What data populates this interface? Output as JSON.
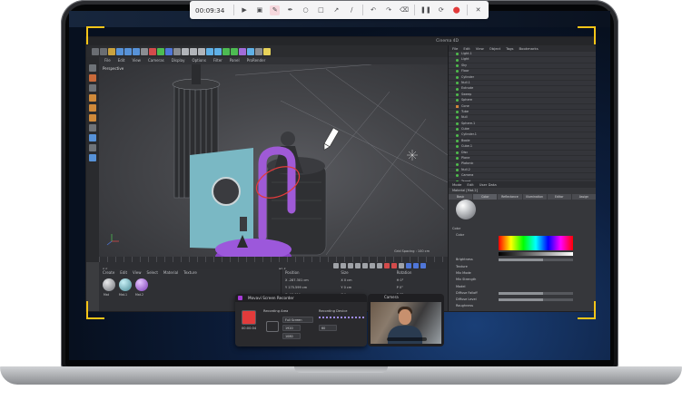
{
  "recorder_toolbar": {
    "timer": "00:09:34",
    "tools": [
      "cursor-icon",
      "region-icon",
      "pen-icon",
      "pencil-icon",
      "circle-icon",
      "square-icon",
      "arrow-icon",
      "line-icon",
      "undo-icon",
      "redo-icon",
      "clear-icon",
      "pause-icon",
      "restart-icon",
      "stop-icon",
      "close-icon"
    ],
    "accent": "#e23b3b",
    "active_tool_bg": "#f6d8dd"
  },
  "app": {
    "window_title": "Cinema 4D",
    "menu": [
      "File",
      "Edit",
      "View",
      "Cameras",
      "Display",
      "Options",
      "Filter",
      "Panel",
      "ProRender"
    ],
    "viewport_label": "Perspective",
    "viewport_footer": "Grid Spacing : 100 cm",
    "frame_start": "0 F",
    "frame_end": "90 F",
    "material_menu": [
      "Create",
      "Edit",
      "View",
      "Select",
      "Material",
      "Texture"
    ],
    "materials": [
      "Mat",
      "Mat.1",
      "Mat.2"
    ],
    "coords": {
      "headers": [
        "Position",
        "Size",
        "Rotation"
      ],
      "rows": [
        [
          "X  -287.301 cm",
          "X  0 cm",
          "H  0°"
        ],
        [
          "Y  175.599 cm",
          "Y  0 cm",
          "P  0°"
        ],
        [
          "Z  -93.819 cm",
          "Z  0 cm",
          "B  0°"
        ]
      ],
      "footer": [
        "Object (Rel)",
        "Size",
        "Apply"
      ]
    },
    "object_manager_menu": [
      "File",
      "Edit",
      "View",
      "Object",
      "Tags",
      "Bookmarks"
    ],
    "objects": [
      "Light.1",
      "Light",
      "Sky",
      "Floor",
      "Cylinder",
      "Null.1",
      "Extrude",
      "Sweep",
      "Sphere",
      "Cone",
      "Tube",
      "Null",
      "Sphere.1",
      "Cube",
      "Cylinder.1",
      "Boole",
      "Cube.1",
      "Disc",
      "Plane",
      "Platonic",
      "Null.2",
      "Camera",
      "Target",
      "Spline",
      "Sweep.1",
      "Tube.1"
    ],
    "attribute_menu": [
      "Mode",
      "Edit",
      "User Data"
    ],
    "attribute_title": "Material [Mat.2]",
    "attribute_tabs": [
      "Basic",
      "Color",
      "Reflectance",
      "Illumination",
      "Editor",
      "Assign"
    ],
    "attribute_labels": [
      "Color",
      "Color",
      "Brightness",
      "Texture",
      "Mix Mode",
      "Mix Strength",
      "Model",
      "Diffuse Falloff",
      "Diffuse Level",
      "Roughness"
    ]
  },
  "recorder_panel": {
    "title": "Movavi Screen Recorder",
    "recording_area_label": "Recording Area",
    "area_value": "Full Screen",
    "recording_device_label": "Recording Device",
    "width": "1920",
    "height": "1080",
    "fps": "60",
    "time": "00:00:04"
  },
  "camera_panel": {
    "title": "Camera"
  },
  "corner_color": "#f5c518"
}
